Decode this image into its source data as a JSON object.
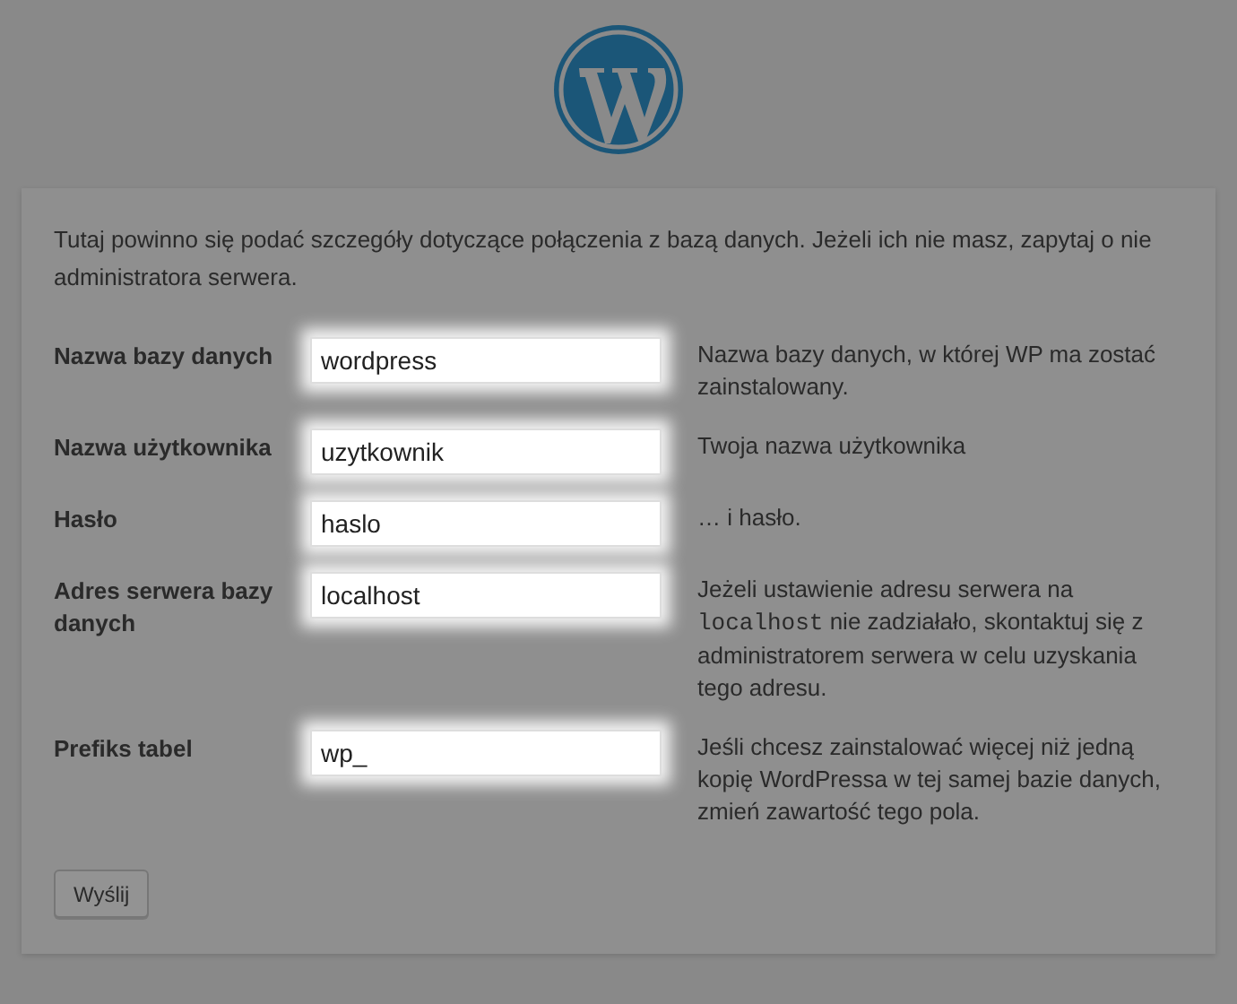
{
  "intro": "Tutaj powinno się podać szczegóły dotyczące połączenia z bazą danych. Jeżeli ich nie masz, zapytaj o nie administratora serwera.",
  "fields": [
    {
      "label": "Nazwa bazy danych",
      "value": "wordpress",
      "help": [
        {
          "kind": "text",
          "text": "Nazwa bazy danych, w której WP ma zostać zainstalowany."
        }
      ]
    },
    {
      "label": "Nazwa użytkownika",
      "value": "uzytkownik",
      "help": [
        {
          "kind": "text",
          "text": "Twoja nazwa użytkownika"
        }
      ]
    },
    {
      "label": "Hasło",
      "value": "haslo",
      "help": [
        {
          "kind": "text",
          "text": "… i hasło."
        }
      ]
    },
    {
      "label": "Adres serwera bazy danych",
      "value": "localhost",
      "help": [
        {
          "kind": "text",
          "text": "Jeżeli ustawienie adresu serwera na "
        },
        {
          "kind": "code",
          "text": "localhost"
        },
        {
          "kind": "text",
          "text": " nie zadziałało, skontaktuj się z administratorem serwera w celu uzyskania tego adresu."
        }
      ]
    },
    {
      "label": "Prefiks tabel",
      "value": "wp_",
      "help": [
        {
          "kind": "text",
          "text": "Jeśli chcesz zainstalować więcej niż jedną kopię WordPressa w tej samej bazie danych, zmień zawartość tego pola."
        }
      ]
    }
  ],
  "submit": "Wyślij"
}
